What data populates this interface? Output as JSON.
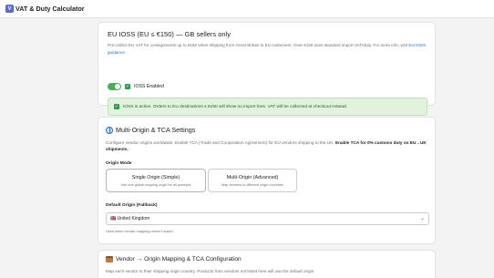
{
  "app": {
    "icon_letter": "V",
    "title": "VAT & Duty Calculator"
  },
  "ioss": {
    "title": "EU IOSS (EU ≤ €150) — GB sellers only",
    "description": "Pre-collect EU VAT for consignments up to €150 when shipping from Great Britain to EU customers. Over €150 uses standard import VAT/duty. For more info, visit",
    "link_text": "EU IOSS guidance",
    "link_suffix": ".",
    "toggle_on": true,
    "checkbox_label": "IOSS Enabled",
    "banner_text": "IOSS is active. Orders to EU destinations ≤ €150 will show no import fees. VAT will be collected at checkout instead."
  },
  "origin": {
    "title": "Multi-Origin & TCA Settings",
    "description": "Configure vendor origins worldwide. Enable TCA (Trade and Cooperation Agreement) for EU vendors shipping to the UK.",
    "description_bold": "Enable TCA for 0% customs duty on EU→UK shipments.",
    "mode_label": "Origin Mode",
    "modes": [
      {
        "name": "Single Origin (Simple)",
        "sub": "Use one global shipping origin for all products",
        "selected": true
      },
      {
        "name": "Multi-Origin (Advanced)",
        "sub": "Map vendors to different origin countries",
        "selected": false
      }
    ],
    "default_label": "Default Origin (Fallback)",
    "default_value": "🇬🇧 United Kingdom",
    "default_help": "Used when vendor mapping doesn't match."
  },
  "vendor": {
    "title": "Vendor → Origin Mapping & TCA Configuration",
    "description": "Map each vendor to their shipping origin country. Products from vendors not listed here will use the default origin."
  },
  "colors": {
    "accent": "#2c6ecb",
    "success": "#4cae5b",
    "banner_bg": "#e3f1df"
  }
}
